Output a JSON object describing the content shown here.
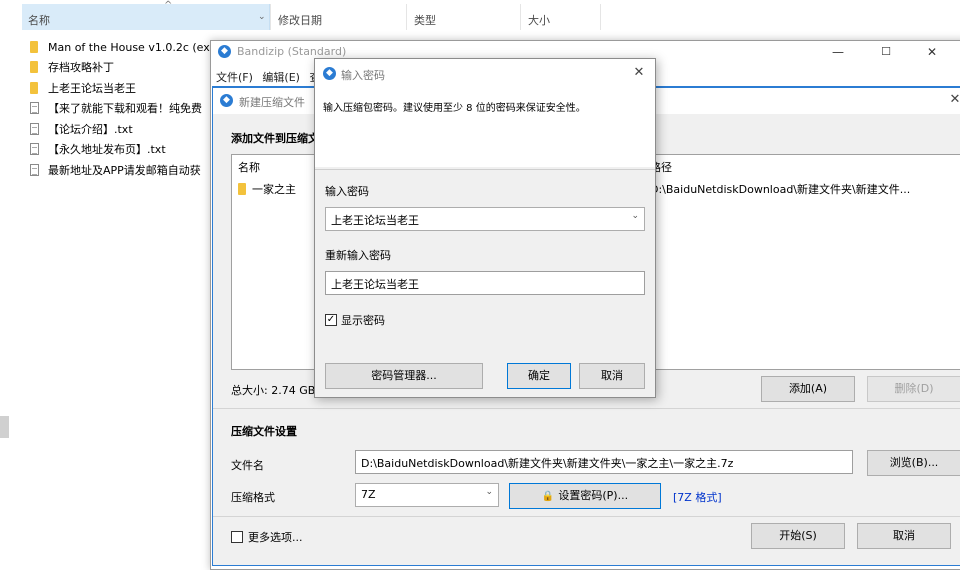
{
  "explorer": {
    "columns": {
      "name": "名称",
      "modified": "修改日期",
      "type": "类型",
      "size": "大小"
    },
    "files": [
      {
        "name": "Man of the House v1.0.2c (ex",
        "kind": "folder"
      },
      {
        "name": "存档攻略补丁",
        "kind": "folder"
      },
      {
        "name": "上老王论坛当老王",
        "kind": "folder"
      },
      {
        "name": "【来了就能下载和观看！纯免费",
        "kind": "doc"
      },
      {
        "name": "【论坛介绍】.txt",
        "kind": "doc"
      },
      {
        "name": "【永久地址发布页】.txt",
        "kind": "doc"
      },
      {
        "name": "最新地址及APP请发邮箱自动获",
        "kind": "doc"
      }
    ]
  },
  "bandizip": {
    "title": "Bandizip (Standard)",
    "menu": {
      "file": "文件(F)",
      "edit": "编辑(E)",
      "more": "查"
    },
    "controls": {
      "minimize": "—",
      "maximize": "☐",
      "close": "✕"
    }
  },
  "new_archive": {
    "title": "新建压缩文件",
    "close": "✕",
    "add_section": "添加文件到压缩文件",
    "list": {
      "col_name": "名称",
      "col_path": "路径",
      "rows": [
        {
          "name": "一家之主",
          "path": "D:\\BaiduNetdiskDownload\\新建文件夹\\新建文件..."
        }
      ]
    },
    "total_size": "总大小: 2.74 GB",
    "add_button": "添加(A)",
    "delete_button": "删除(D)",
    "settings_section": "压缩文件设置",
    "filename_label": "文件名",
    "filename_value": "D:\\BaiduNetdiskDownload\\新建文件夹\\新建文件夹\\一家之主\\一家之主.7z",
    "browse_button": "浏览(B)...",
    "format_label": "压缩格式",
    "format_value": "7Z",
    "set_password_button": "设置密码(P)...",
    "format_link": "[7Z 格式]",
    "more_options": "更多选项...",
    "start_button": "开始(S)",
    "cancel_button": "取消"
  },
  "password_dialog": {
    "title": "输入密码",
    "close": "✕",
    "description": "输入压缩包密码。建议使用至少 8 位的密码来保证安全性。",
    "enter_label": "输入密码",
    "enter_value": "上老王论坛当老王",
    "reenter_label": "重新输入密码",
    "reenter_value": "上老王论坛当老王",
    "show_password": "显示密码",
    "show_password_checked": "✓",
    "manager_button": "密码管理器...",
    "ok_button": "确定",
    "cancel_button": "取消"
  },
  "colors": {
    "accent": "#2b7cd3",
    "selected_header": "#d9ebf9",
    "folder": "#f3c23c",
    "link": "#0033cc"
  }
}
